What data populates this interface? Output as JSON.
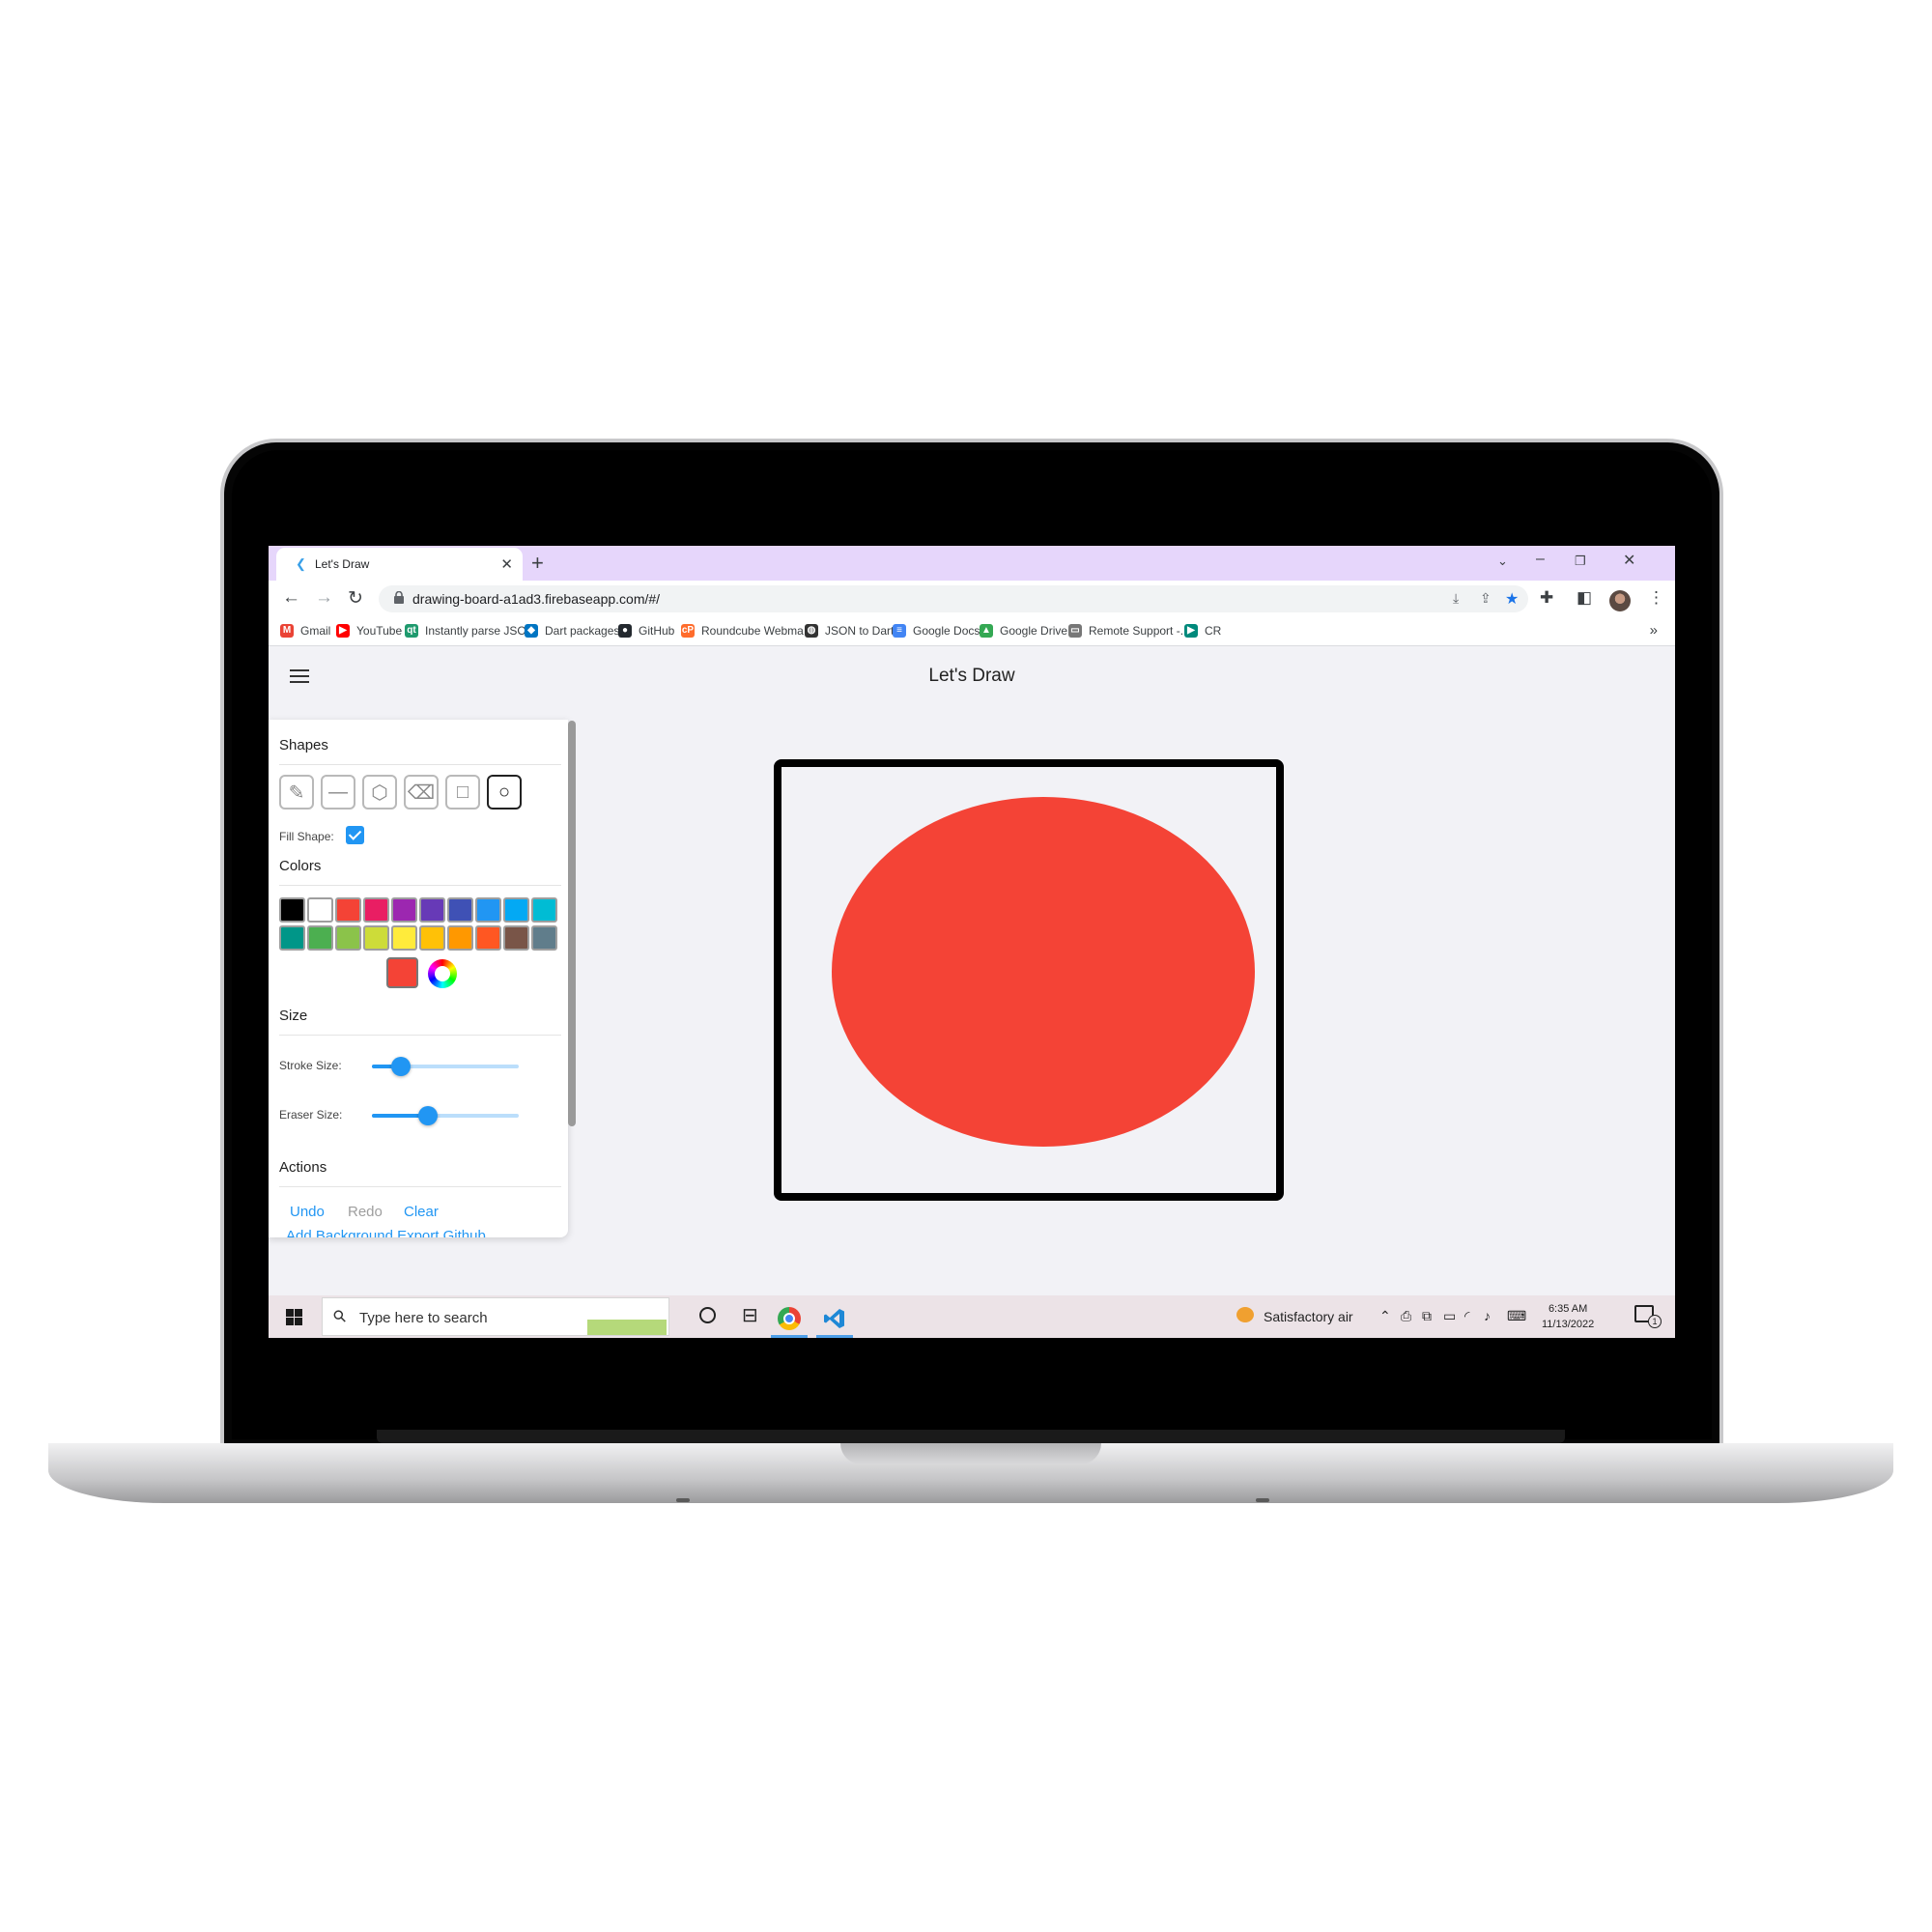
{
  "browser": {
    "tab_title": "Let's Draw",
    "new_tab_label": "+",
    "url": "drawing-board-a1ad3.firebaseapp.com/#/",
    "bookmarks": [
      {
        "label": "Gmail",
        "icon": "gmail-icon",
        "color": "#ea4335",
        "glyph": "M"
      },
      {
        "label": "YouTube",
        "icon": "youtube-icon",
        "color": "#ff0000",
        "glyph": "▶"
      },
      {
        "label": "Instantly parse JSO...",
        "icon": "quicktype-icon",
        "color": "#1f9a6e",
        "glyph": "qt"
      },
      {
        "label": "Dart packages",
        "icon": "dart-icon",
        "color": "#0175c2",
        "glyph": "◆"
      },
      {
        "label": "GitHub",
        "icon": "github-icon",
        "color": "#24292f",
        "glyph": "●"
      },
      {
        "label": "Roundcube Webma...",
        "icon": "cpanel-icon",
        "color": "#ff6c2c",
        "glyph": "cP"
      },
      {
        "label": "JSON to Dart",
        "icon": "globe-icon",
        "color": "#333333",
        "glyph": "◍"
      },
      {
        "label": "Google Docs",
        "icon": "google-docs-icon",
        "color": "#4285f4",
        "glyph": "≡"
      },
      {
        "label": "Google Drive",
        "icon": "google-drive-icon",
        "color": "#34a853",
        "glyph": "▲"
      },
      {
        "label": "Remote Support -...",
        "icon": "remote-support-icon",
        "color": "#777777",
        "glyph": "▭"
      },
      {
        "label": "CR",
        "icon": "google-meet-icon",
        "color": "#00897b",
        "glyph": "▶"
      }
    ],
    "bookmarks_more": "»"
  },
  "app": {
    "title": "Let's Draw",
    "panel": {
      "shapes_title": "Shapes",
      "shape_tools": [
        {
          "name": "pencil-tool",
          "glyph": "✎",
          "selected": false
        },
        {
          "name": "line-tool",
          "glyph": "—",
          "selected": false
        },
        {
          "name": "polygon-tool",
          "glyph": "⬡",
          "selected": false
        },
        {
          "name": "eraser-tool",
          "glyph": "⌫",
          "selected": false
        },
        {
          "name": "rectangle-tool",
          "glyph": "□",
          "selected": false
        },
        {
          "name": "circle-tool",
          "glyph": "○",
          "selected": true
        }
      ],
      "fill_shape_label": "Fill Shape:",
      "fill_shape_checked": true,
      "colors_title": "Colors",
      "colors_row1": [
        "#000000",
        "#ffffff",
        "#f44336",
        "#e91e63",
        "#9c27b0",
        "#673ab7",
        "#3f51b5",
        "#2196f3",
        "#03a9f4",
        "#00bcd4"
      ],
      "colors_row2": [
        "#009688",
        "#4caf50",
        "#8bc34a",
        "#cddc39",
        "#ffeb3b",
        "#ffc107",
        "#ff9800",
        "#ff5722",
        "#795548",
        "#607d8b"
      ],
      "selected_color": "#f44336",
      "size_title": "Size",
      "stroke_size_label": "Stroke Size:",
      "stroke_size_value": 0.2,
      "eraser_size_label": "Eraser Size:",
      "eraser_size_value": 0.38,
      "actions_title": "Actions",
      "undo_label": "Undo",
      "redo_label": "Redo",
      "clear_label": "Clear",
      "more_actions_cut": "Add Background  Export  Github"
    },
    "canvas_fill_color": "#f44336"
  },
  "taskbar": {
    "search_placeholder": "Type here to search",
    "weather": "Satisfactory air",
    "time": "6:35 AM",
    "date": "11/13/2022",
    "notification_count": "1"
  }
}
